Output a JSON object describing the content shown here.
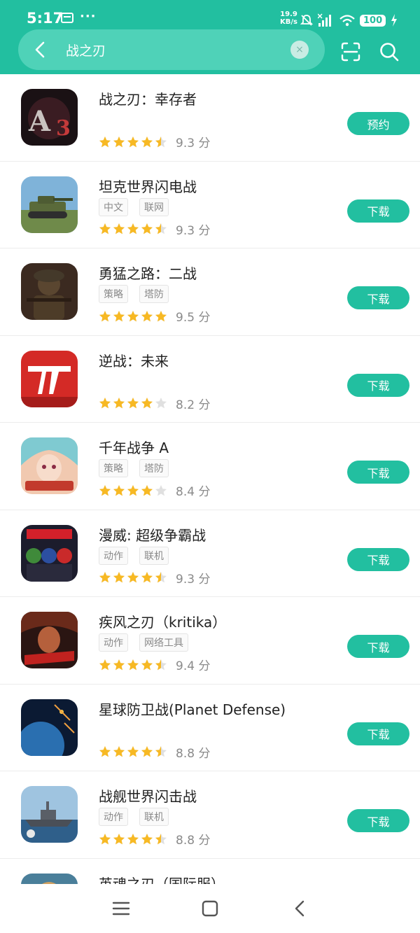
{
  "status_bar": {
    "time": "5:17",
    "dots": "···",
    "net_speed_value": "19.9",
    "net_speed_unit": "KB/s",
    "battery": "100"
  },
  "search": {
    "query": "战之刃",
    "clear_symbol": "×"
  },
  "results": [
    {
      "name": "战之刃：幸存者",
      "tags": [],
      "stars": 4.5,
      "score": "9.3 分",
      "action": "预约",
      "icon": "a3-game-icon"
    },
    {
      "name": "坦克世界闪电战",
      "tags": [
        "中文",
        "联网"
      ],
      "stars": 4.5,
      "score": "9.3 分",
      "action": "下载",
      "icon": "tank-game-icon"
    },
    {
      "name": "勇猛之路：二战",
      "tags": [
        "策略",
        "塔防"
      ],
      "stars": 5,
      "score": "9.5 分",
      "action": "下载",
      "icon": "soldier-game-icon"
    },
    {
      "name": "逆战：未来",
      "tags": [],
      "stars": 4,
      "score": "8.2 分",
      "action": "下载",
      "icon": "nizhan-game-icon"
    },
    {
      "name": "千年战争 A",
      "tags": [
        "策略",
        "塔防"
      ],
      "stars": 4,
      "score": "8.4 分",
      "action": "下载",
      "icon": "anime-girl-game-icon"
    },
    {
      "name": "漫威: 超级争霸战",
      "tags": [
        "动作",
        "联机"
      ],
      "stars": 4.5,
      "score": "9.3 分",
      "action": "下载",
      "icon": "marvel-game-icon"
    },
    {
      "name": "疾风之刃（kritika）",
      "tags": [
        "动作",
        "网络工具"
      ],
      "stars": 4.5,
      "score": "9.4 分",
      "action": "下载",
      "icon": "kritika-game-icon"
    },
    {
      "name": "星球防卫战(Planet Defense)",
      "tags": [],
      "stars": 4.5,
      "score": "8.8 分",
      "action": "下载",
      "icon": "planet-game-icon"
    },
    {
      "name": "战舰世界闪击战",
      "tags": [
        "动作",
        "联机"
      ],
      "stars": 4.5,
      "score": "8.8 分",
      "action": "下载",
      "icon": "warship-game-icon"
    },
    {
      "name": "英魂之刃（国际服）",
      "tags": [],
      "stars": 0,
      "score": "",
      "action": "",
      "icon": "hero-game-icon"
    }
  ],
  "colors": {
    "accent": "#22bfa0",
    "star_on": "#f7b924",
    "star_off": "#e0e0e0"
  }
}
